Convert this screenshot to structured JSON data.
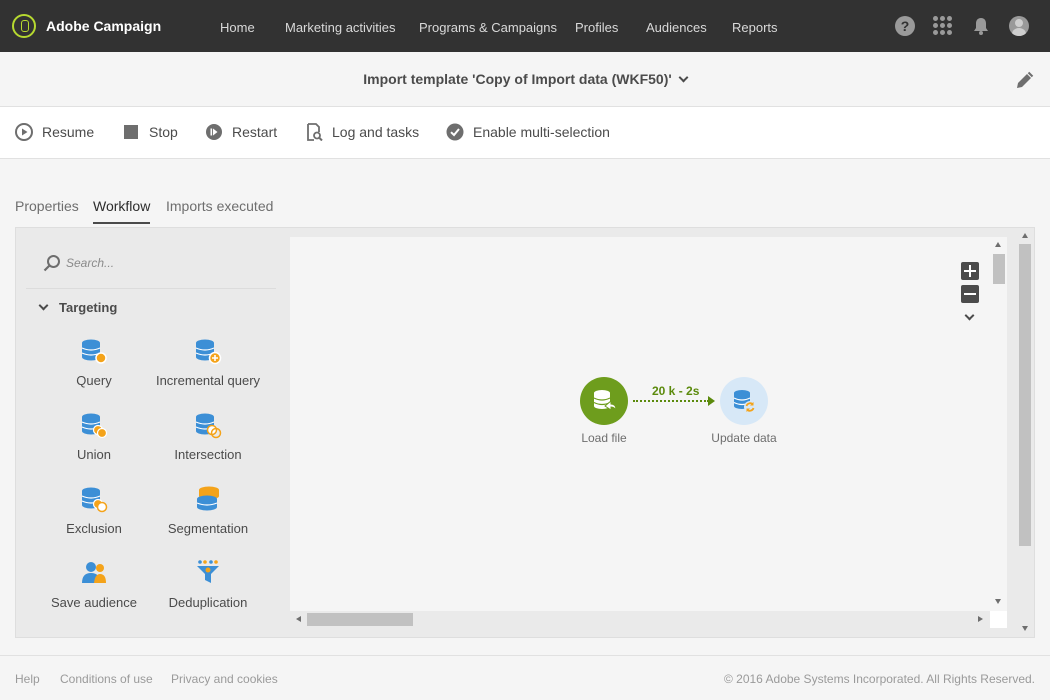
{
  "app": {
    "name": "Adobe Campaign"
  },
  "nav": {
    "items": [
      {
        "label": "Home"
      },
      {
        "label": "Marketing activities"
      },
      {
        "label": "Programs & Campaigns"
      },
      {
        "label": "Profiles"
      },
      {
        "label": "Audiences"
      },
      {
        "label": "Reports"
      }
    ],
    "help_glyph": "?"
  },
  "header": {
    "title": "Import template 'Copy of Import data (WKF50)'"
  },
  "toolbar": {
    "resume_label": "Resume",
    "stop_label": "Stop",
    "restart_label": "Restart",
    "log_label": "Log and tasks",
    "multiselect_label": "Enable multi-selection"
  },
  "tabs": [
    {
      "label": "Properties",
      "active": false
    },
    {
      "label": "Workflow",
      "active": true
    },
    {
      "label": "Imports executed",
      "active": false
    }
  ],
  "palette": {
    "search_placeholder": "Search...",
    "group_label": "Targeting",
    "activities": [
      {
        "label": "Query",
        "icon": "query-icon"
      },
      {
        "label": "Incremental query",
        "icon": "incremental-query-icon"
      },
      {
        "label": "Union",
        "icon": "union-icon"
      },
      {
        "label": "Intersection",
        "icon": "intersection-icon"
      },
      {
        "label": "Exclusion",
        "icon": "exclusion-icon"
      },
      {
        "label": "Segmentation",
        "icon": "segmentation-icon"
      },
      {
        "label": "Save audience",
        "icon": "save-audience-icon"
      },
      {
        "label": "Deduplication",
        "icon": "deduplication-icon"
      }
    ]
  },
  "canvas": {
    "nodes": [
      {
        "label": "Load file",
        "icon": "load-file-icon"
      },
      {
        "label": "Update data",
        "icon": "update-data-icon"
      }
    ],
    "transition_label": "20 k - 2s"
  },
  "footer": {
    "links": [
      {
        "label": "Help"
      },
      {
        "label": "Conditions of use"
      },
      {
        "label": "Privacy and cookies"
      }
    ],
    "copyright": "© 2016 Adobe Systems Incorporated. All Rights Reserved."
  },
  "colors": {
    "topbar": "#323232",
    "brand_accent": "#b6d930",
    "activity_blue": "#3c8fd6",
    "activity_orange": "#f4a31a",
    "load_node_green": "#6e9d1d",
    "update_node_bg": "#d7e8f7",
    "transition_green": "#5b8a0c"
  }
}
